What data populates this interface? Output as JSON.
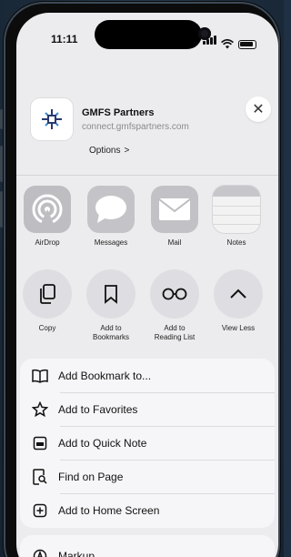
{
  "status": {
    "time": "11:11"
  },
  "site": {
    "name": "GMFS Partners",
    "url": "connect.gmfspartners.com",
    "options_label": "Options",
    "options_chevron": ">"
  },
  "close": {
    "symbol": "✕"
  },
  "share_apps": [
    {
      "label": "AirDrop",
      "icon": "airdrop-icon"
    },
    {
      "label": "Messages",
      "icon": "messages-icon"
    },
    {
      "label": "Mail",
      "icon": "mail-icon"
    },
    {
      "label": "Notes",
      "icon": "notes-icon"
    }
  ],
  "actions": [
    {
      "label": "Copy",
      "icon": "copy-icon"
    },
    {
      "label": "Add to\nBookmarks",
      "icon": "bookmark-icon"
    },
    {
      "label": "Add to\nReading List",
      "icon": "glasses-icon"
    },
    {
      "label": "View Less",
      "icon": "chevron-up-icon"
    }
  ],
  "menu": [
    {
      "label": "Add Bookmark to...",
      "icon": "book-icon"
    },
    {
      "label": "Add to Favorites",
      "icon": "star-icon"
    },
    {
      "label": "Add to Quick Note",
      "icon": "quick-note-icon"
    },
    {
      "label": "Find on Page",
      "icon": "find-on-page-icon"
    },
    {
      "label": "Add to Home Screen",
      "icon": "plus-square-icon"
    }
  ],
  "menu2": [
    {
      "label": "Markup",
      "icon": "markup-icon"
    }
  ]
}
